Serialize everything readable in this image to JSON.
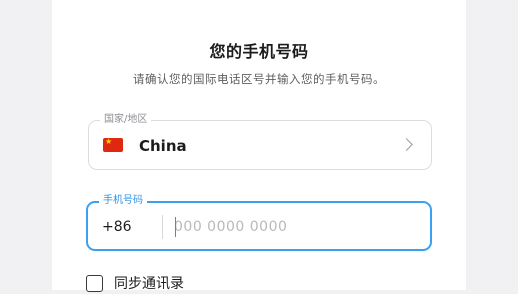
{
  "page": {
    "title": "您的手机号码",
    "subtitle": "请确认您的国际电话区号并输入您的手机号码。"
  },
  "country_field": {
    "label": "国家/地区",
    "flag_icon": "china-flag-icon",
    "value": "China",
    "chevron_icon": "chevron-right-icon"
  },
  "phone_field": {
    "label": "手机号码",
    "dial_code": "+86",
    "placeholder": "000 0000 0000",
    "value": "",
    "focused": true,
    "accent_color": "#3aa0f2"
  },
  "sync_contacts": {
    "label": "同步通讯录",
    "checked": false
  }
}
